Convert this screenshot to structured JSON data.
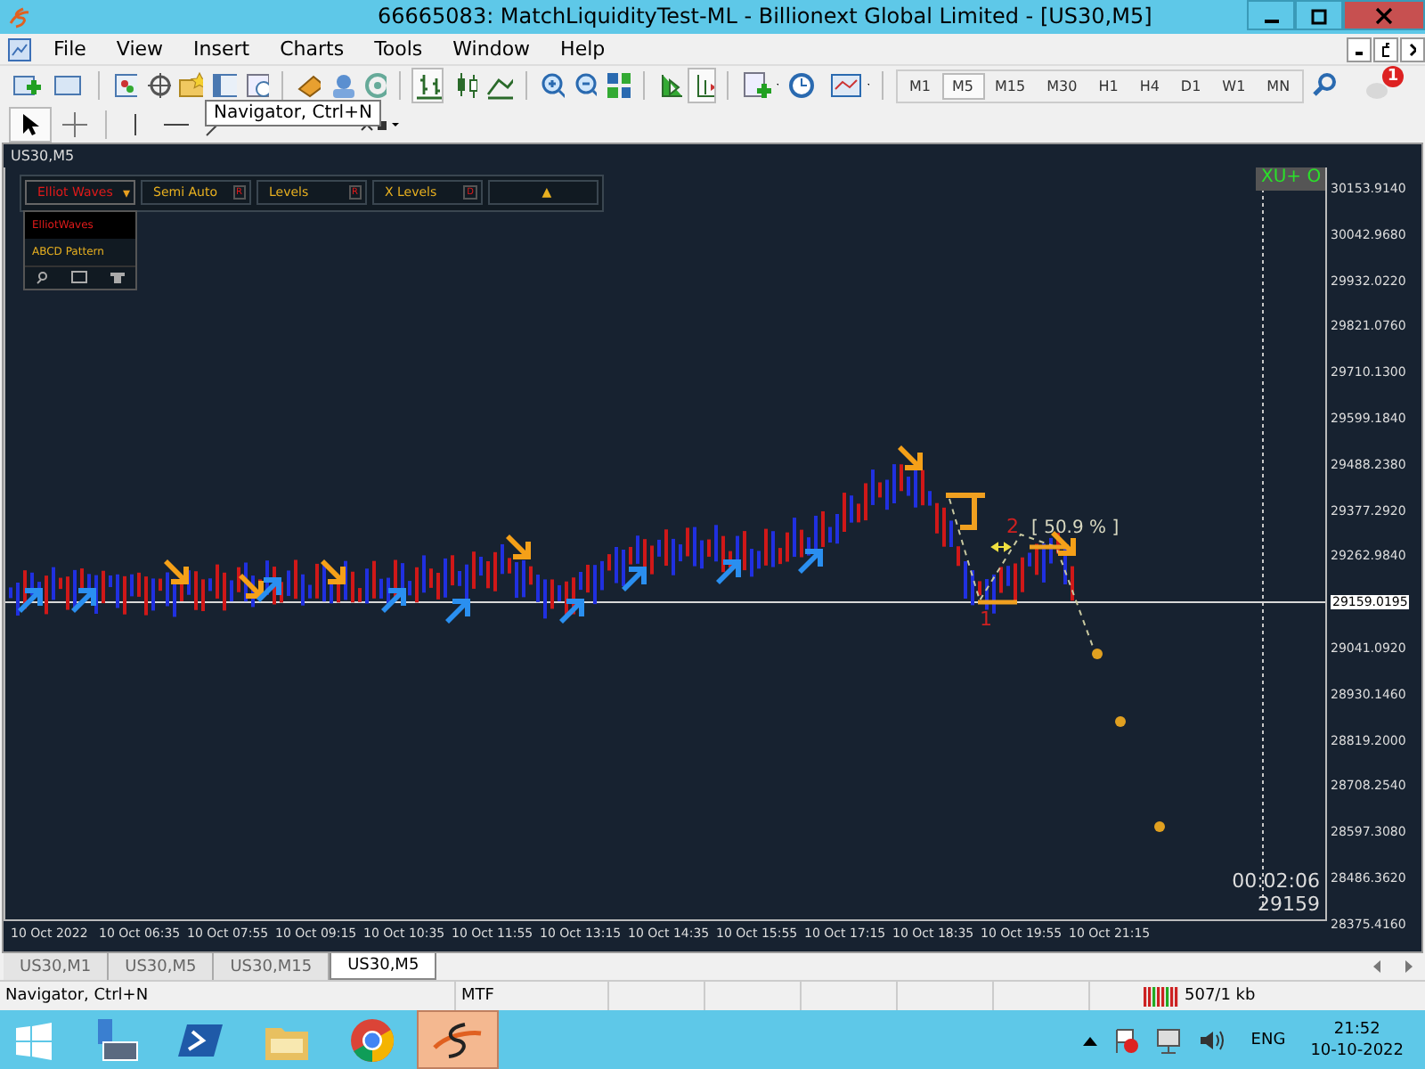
{
  "window": {
    "title": "66665083: MatchLiquidityTest-ML - Billionext Global Limited - [US30,M5]"
  },
  "menu": [
    "File",
    "View",
    "Insert",
    "Charts",
    "Tools",
    "Window",
    "Help"
  ],
  "timeframes": [
    {
      "label": "M1",
      "selected": false
    },
    {
      "label": "M5",
      "selected": true
    },
    {
      "label": "M15",
      "selected": false
    },
    {
      "label": "M30",
      "selected": false
    },
    {
      "label": "H1",
      "selected": false
    },
    {
      "label": "H4",
      "selected": false
    },
    {
      "label": "D1",
      "selected": false
    },
    {
      "label": "W1",
      "selected": false
    },
    {
      "label": "MN",
      "selected": false
    }
  ],
  "notification_count": "1",
  "tooltip": "Navigator, Ctrl+N",
  "chart": {
    "title": "US30,M5",
    "panel": [
      {
        "label": "Elliot Waves",
        "kind": "dropdown",
        "badge": "▾"
      },
      {
        "label": "Semi Auto",
        "kind": "button",
        "badge": "R"
      },
      {
        "label": "Levels",
        "kind": "button",
        "badge": "R"
      },
      {
        "label": "X Levels",
        "kind": "button",
        "badge": "D"
      },
      {
        "label": "▲",
        "kind": "toggle"
      }
    ],
    "dropdown": [
      {
        "label": "ElliotWaves",
        "selected": true
      },
      {
        "label": "ABCD Pattern",
        "selected": false
      }
    ],
    "status_tag": "XU+ O",
    "wave_labels": [
      "1",
      "2"
    ],
    "retracement": "[ 50.9 % ]",
    "countdown": "00:02:06",
    "last_price": "29159",
    "price_ticks": [
      "30153.9140",
      "30042.9680",
      "29932.0220",
      "29821.0760",
      "29710.1300",
      "29599.1840",
      "29488.2380",
      "29377.2920",
      "29262.9840",
      "29159.0195",
      "29041.0920",
      "28930.1460",
      "28819.2000",
      "28708.2540",
      "28597.3080",
      "28486.3620",
      "28375.4160"
    ],
    "time_ticks": [
      "10 Oct 2022",
      "10 Oct 06:35",
      "10 Oct 07:55",
      "10 Oct 09:15",
      "10 Oct 10:35",
      "10 Oct 11:55",
      "10 Oct 13:15",
      "10 Oct 14:35",
      "10 Oct 15:55",
      "10 Oct 17:15",
      "10 Oct 18:35",
      "10 Oct 19:55",
      "10 Oct 21:15"
    ]
  },
  "chart_tabs": [
    {
      "label": "US30,M1",
      "selected": false
    },
    {
      "label": "US30,M5",
      "selected": false
    },
    {
      "label": "US30,M15",
      "selected": false
    },
    {
      "label": "US30,M5",
      "selected": true
    }
  ],
  "status_bar": {
    "hint": "Navigator, Ctrl+N",
    "profile": "MTF",
    "traffic": "507/1 kb"
  },
  "taskbar": {
    "language": "ENG",
    "time": "21:52",
    "date": "10-10-2022"
  }
}
